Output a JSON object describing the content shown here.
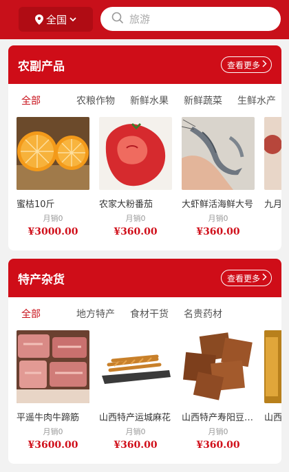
{
  "header": {
    "region_label": "全国",
    "search_placeholder": "旅游"
  },
  "colors": {
    "brand": "#c8101a",
    "price": "#d0101b"
  },
  "sections": [
    {
      "title": "农副产品",
      "more_label": "查看更多",
      "tabs": [
        "全部",
        "农粮作物",
        "新鲜水果",
        "新鲜蔬菜",
        "生鲜水产"
      ],
      "products": [
        {
          "name": "蜜桔10斤",
          "sales": "月销0",
          "price": "¥3000.00",
          "image": "orange"
        },
        {
          "name": "农家大粉番茄",
          "sales": "月销0",
          "price": "¥360.00",
          "image": "tomato"
        },
        {
          "name": "大虾鲜活海鲜大号",
          "sales": "月销0",
          "price": "¥360.00",
          "image": "shrimp"
        },
        {
          "name": "九月",
          "sales": "",
          "price": "",
          "image": "partial"
        }
      ]
    },
    {
      "title": "特产杂货",
      "more_label": "查看更多",
      "tabs": [
        "全部",
        "地方特产",
        "食材干货",
        "名贵药材"
      ],
      "products": [
        {
          "name": "平遥牛肉牛蹄筋",
          "sales": "月销0",
          "price": "¥3600.00",
          "image": "beef"
        },
        {
          "name": "山西特产运城麻花",
          "sales": "月销0",
          "price": "¥360.00",
          "image": "twist"
        },
        {
          "name": "山西特产寿阳豆腐干",
          "sales": "月销0",
          "price": "¥360.00",
          "image": "tofu"
        },
        {
          "name": "山西",
          "sales": "",
          "price": "",
          "image": "partial"
        }
      ]
    }
  ]
}
